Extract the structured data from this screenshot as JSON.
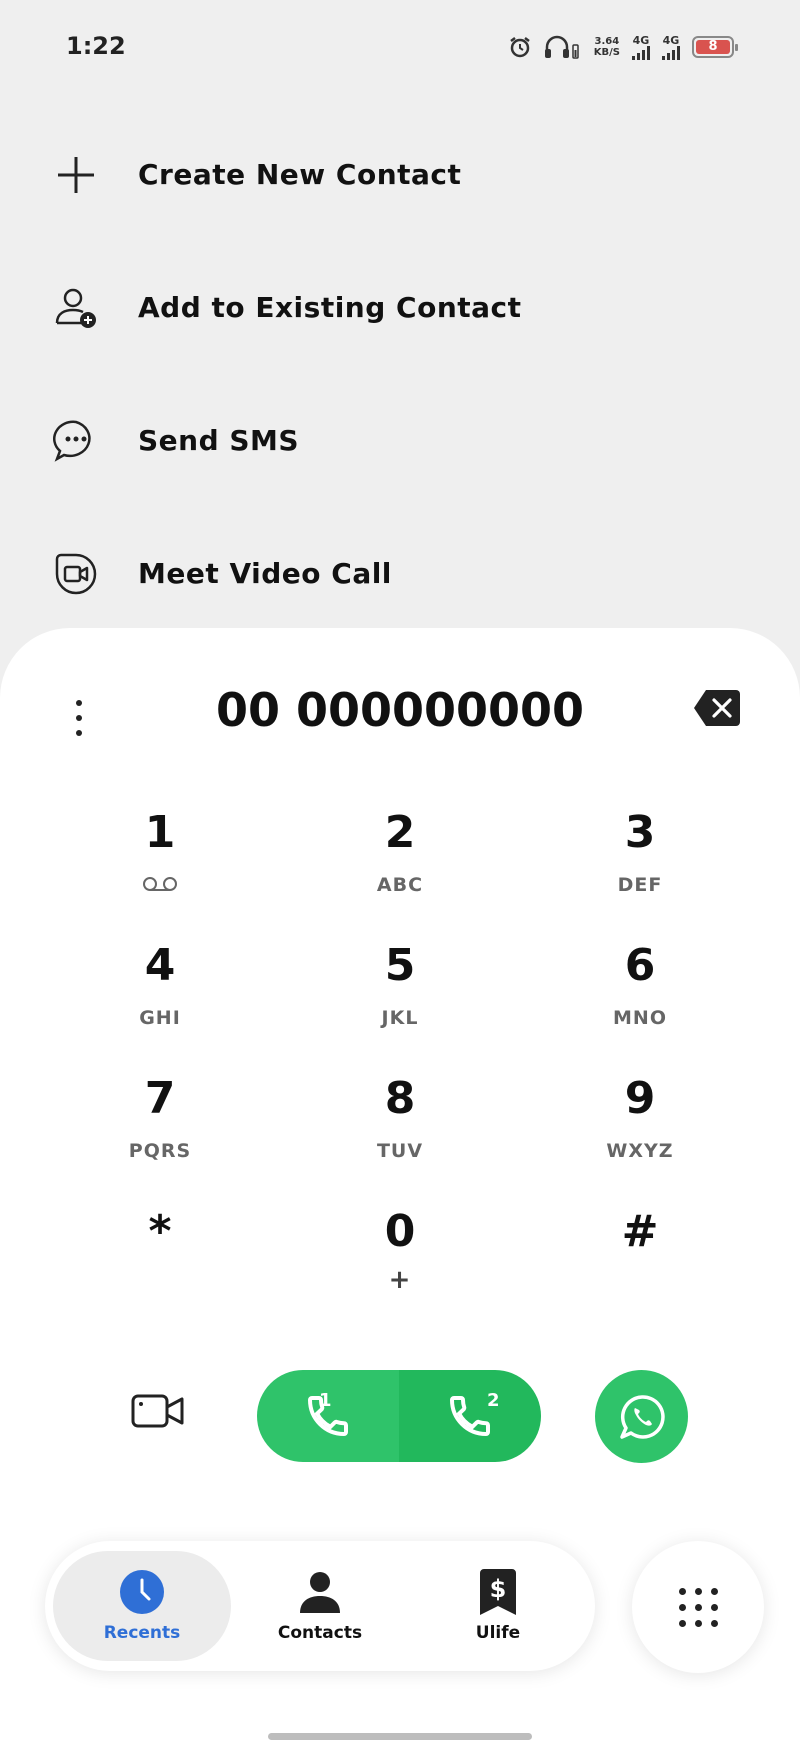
{
  "status_bar": {
    "time": "1:22",
    "net_speed_value": "3.64",
    "net_speed_unit": "KB/S",
    "sim1_network": "4G",
    "sim2_network": "4G",
    "battery_level": "8",
    "icons": [
      "alarm-icon",
      "headphones-icon",
      "signal-icon",
      "battery-icon"
    ]
  },
  "actions": [
    {
      "label": "Create New Contact",
      "icon": "plus-icon"
    },
    {
      "label": "Add to Existing Contact",
      "icon": "add-person-icon"
    },
    {
      "label": "Send SMS",
      "icon": "sms-icon"
    },
    {
      "label": "Meet Video Call",
      "icon": "meet-video-icon"
    }
  ],
  "dialer": {
    "number": "00 000000000",
    "keys": [
      {
        "digit": "1",
        "letters": ""
      },
      {
        "digit": "2",
        "letters": "ABC"
      },
      {
        "digit": "3",
        "letters": "DEF"
      },
      {
        "digit": "4",
        "letters": "GHI"
      },
      {
        "digit": "5",
        "letters": "JKL"
      },
      {
        "digit": "6",
        "letters": "MNO"
      },
      {
        "digit": "7",
        "letters": "PQRS"
      },
      {
        "digit": "8",
        "letters": "TUV"
      },
      {
        "digit": "9",
        "letters": "WXYZ"
      },
      {
        "digit": "*",
        "letters": ""
      },
      {
        "digit": "0",
        "letters": "+"
      },
      {
        "digit": "#",
        "letters": ""
      }
    ],
    "call_sim1": "1",
    "call_sim2": "2"
  },
  "nav": {
    "items": [
      {
        "label": "Recents",
        "active": true
      },
      {
        "label": "Contacts",
        "active": false
      },
      {
        "label": "Ulife",
        "active": false
      }
    ]
  },
  "colors": {
    "accent": "#2f6fd6",
    "call_green": "#2fc36a",
    "battery_low": "#d9534f"
  }
}
